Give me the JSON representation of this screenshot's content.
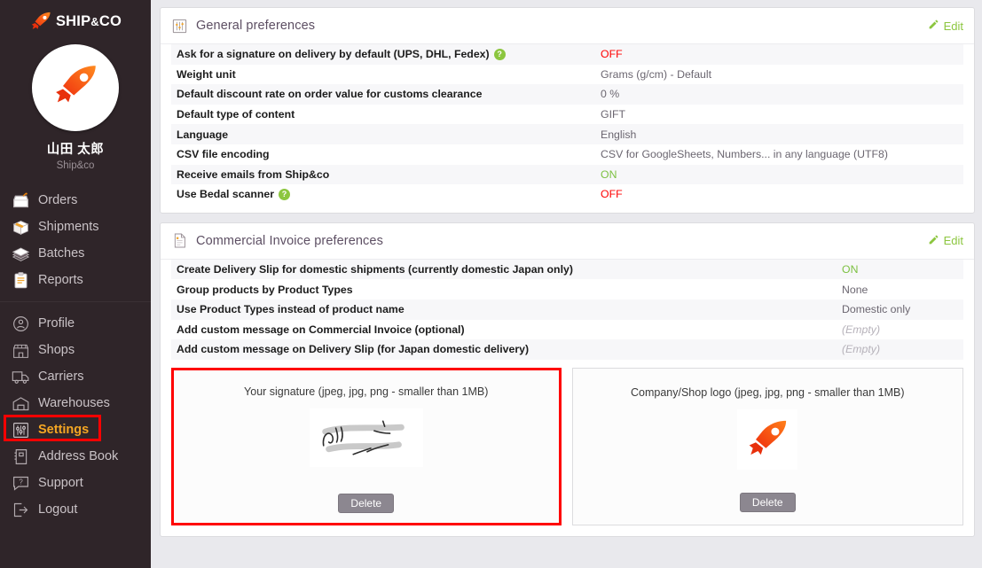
{
  "sidebar": {
    "brand": {
      "name": "SHIP",
      "amp": "&",
      "co": "CO",
      "logo_icon": "rocket-logo-icon"
    },
    "user": {
      "name": "山田 太郎",
      "shop": "Ship&co",
      "avatar_icon": "rocket-avatar-icon"
    },
    "group_primary": [
      {
        "label": "Orders",
        "icon": "orders-icon",
        "active": false
      },
      {
        "label": "Shipments",
        "icon": "shipments-box-icon",
        "active": false
      },
      {
        "label": "Batches",
        "icon": "batches-stack-icon",
        "active": false
      },
      {
        "label": "Reports",
        "icon": "reports-clipboard-icon",
        "active": false
      }
    ],
    "group_secondary": [
      {
        "label": "Profile",
        "icon": "profile-person-icon",
        "active": false
      },
      {
        "label": "Shops",
        "icon": "shops-store-icon",
        "active": false
      },
      {
        "label": "Carriers",
        "icon": "carriers-truck-icon",
        "active": false
      },
      {
        "label": "Warehouses",
        "icon": "warehouses-building-icon",
        "active": false
      },
      {
        "label": "Settings",
        "icon": "settings-sliders-icon",
        "active": true
      },
      {
        "label": "Address Book",
        "icon": "address-book-icon",
        "active": false
      },
      {
        "label": "Support",
        "icon": "support-help-icon",
        "active": false
      },
      {
        "label": "Logout",
        "icon": "logout-arrow-icon",
        "active": false
      }
    ]
  },
  "general_panel": {
    "title": "General preferences",
    "icon": "sliders-icon",
    "edit_label": "Edit",
    "edit_icon": "pencil-icon",
    "rows": [
      {
        "label": "Ask for a signature on delivery by default (UPS, DHL, Fedex)",
        "help": true,
        "value": "OFF",
        "state": "off"
      },
      {
        "label": "Weight unit",
        "help": false,
        "value": "Grams (g/cm) - Default",
        "state": "normal"
      },
      {
        "label": "Default discount rate on order value for customs clearance",
        "help": false,
        "value": "0 %",
        "state": "normal"
      },
      {
        "label": "Default type of content",
        "help": false,
        "value": "GIFT",
        "state": "normal"
      },
      {
        "label": "Language",
        "help": false,
        "value": "English",
        "state": "normal"
      },
      {
        "label": "CSV file encoding",
        "help": false,
        "value": "CSV for GoogleSheets, Numbers... in any language (UTF8)",
        "state": "normal"
      },
      {
        "label": "Receive emails from Ship&co",
        "help": false,
        "value": "ON",
        "state": "on"
      },
      {
        "label": "Use Bedal scanner",
        "help": true,
        "value": "OFF",
        "state": "off"
      }
    ]
  },
  "invoice_panel": {
    "title": "Commercial Invoice preferences",
    "icon": "document-icon",
    "edit_label": "Edit",
    "edit_icon": "pencil-icon",
    "rows": [
      {
        "label": "Create Delivery Slip for domestic shipments (currently domestic Japan only)",
        "help": false,
        "value": "ON",
        "state": "on"
      },
      {
        "label": "Group products by Product Types",
        "help": false,
        "value": "None",
        "state": "normal"
      },
      {
        "label": "Use Product Types instead of product name",
        "help": false,
        "value": "Domestic only",
        "state": "normal"
      },
      {
        "label": "Add custom message on Commercial Invoice (optional)",
        "help": false,
        "value": "(Empty)",
        "state": "empty"
      },
      {
        "label": "Add custom message on Delivery Slip (for Japan domestic delivery)",
        "help": false,
        "value": "(Empty)",
        "state": "empty"
      }
    ],
    "uploads": [
      {
        "title": "Your signature (jpeg, jpg, png - smaller than 1MB)",
        "delete_label": "Delete",
        "thumb_icon": "signature-image",
        "highlighted": true
      },
      {
        "title": "Company/Shop logo (jpeg, jpg, png - smaller than 1MB)",
        "delete_label": "Delete",
        "thumb_icon": "rocket-logo-image",
        "highlighted": false
      }
    ]
  },
  "colors": {
    "sidebar_bg": "#2f2529",
    "accent_orange": "#f5a623",
    "highlight_red": "#ff0000",
    "green": "#7dc142",
    "edit_green": "#8cc63f",
    "off_red": "#ff0000",
    "title_purple": "#5d4f63"
  }
}
